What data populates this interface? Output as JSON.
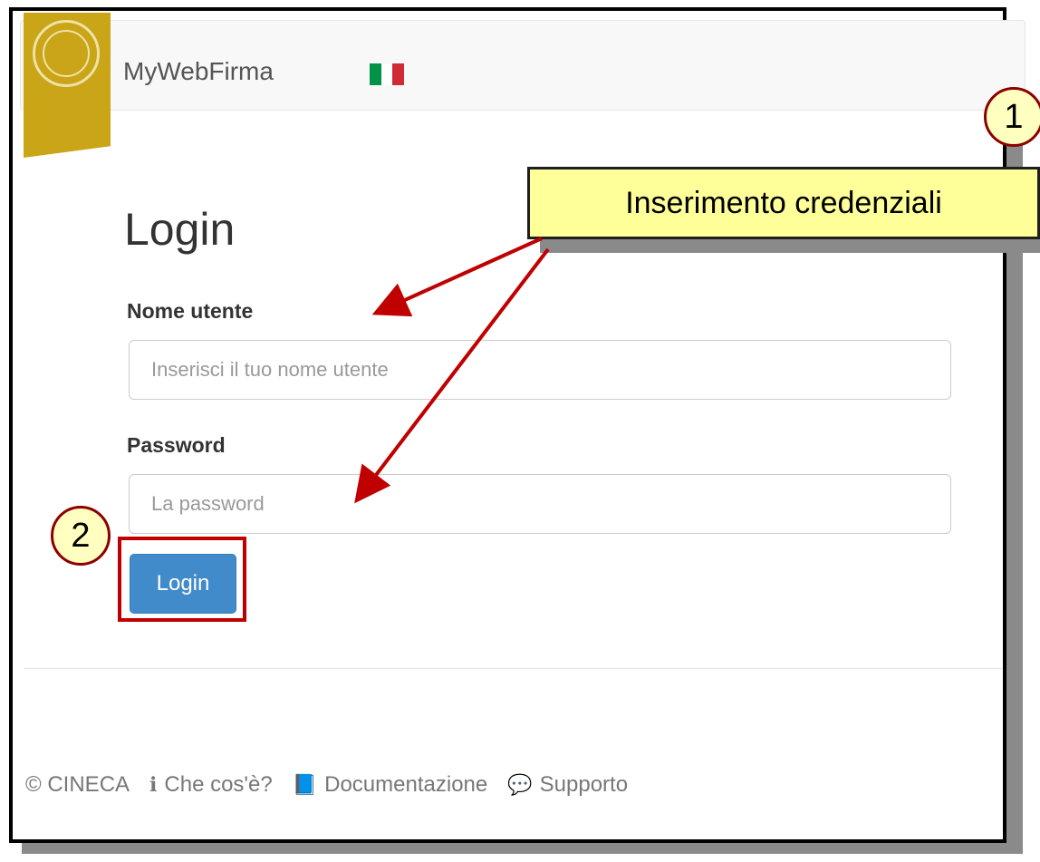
{
  "app": {
    "brand": "MyWebFirma",
    "flag_colors": [
      "#009246",
      "#ffffff",
      "#ce2b37"
    ],
    "ribbon_color": "#c9a517"
  },
  "login": {
    "title": "Login",
    "username_label": "Nome utente",
    "username_placeholder": "Inserisci il tuo nome utente",
    "password_label": "Password",
    "password_placeholder": "La password",
    "button_label": "Login",
    "button_color": "#428bca"
  },
  "footer": {
    "copyright": "© CINECA",
    "items": [
      {
        "icon": "info-circle-icon",
        "label": "Che cos'è?"
      },
      {
        "icon": "book-icon",
        "label": "Documentazione"
      },
      {
        "icon": "chat-bubbles-icon",
        "label": "Supporto"
      }
    ]
  },
  "annotations": {
    "step1": "1",
    "step2": "2",
    "callout": "Inserimento credenziali",
    "highlight_color": "#c00000"
  }
}
